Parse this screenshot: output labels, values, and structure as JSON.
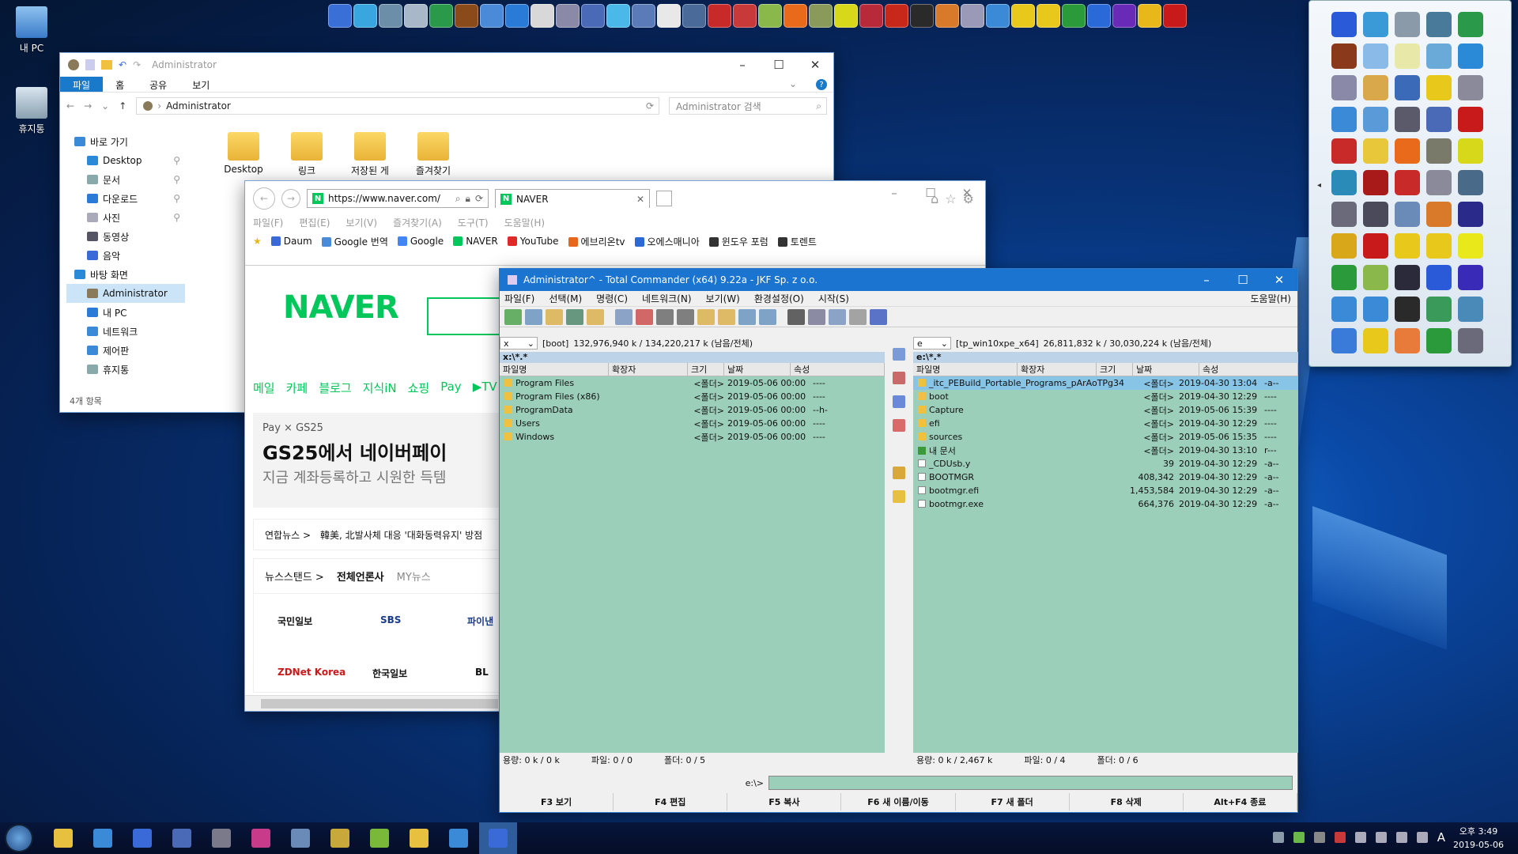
{
  "desktop": {
    "icons": [
      {
        "label": "내 PC",
        "icon": "computer-icon"
      },
      {
        "label": "휴지통",
        "icon": "recycle-bin-icon"
      }
    ]
  },
  "quick_bar": [
    "#3a6fd8",
    "#3aa6e0",
    "#6c8ea8",
    "#a8b8c8",
    "#2a9a4a",
    "#8a4a1a",
    "#4a8ad8",
    "#2a7ad8",
    "#d8d8d8",
    "#8a8aa8",
    "#4a6ab8",
    "#4ab8e8",
    "#5a7ab8",
    "#e8e8e8",
    "#4a6a9a",
    "#c82a2a",
    "#c83a3a",
    "#8ab84a",
    "#e86a1a",
    "#8a9a5a",
    "#d8d81a",
    "#b82a3a",
    "#c8281a",
    "#2a2a2a",
    "#d87a2a",
    "#9a9ab8",
    "#3a8ad8",
    "#e8c81a",
    "#e8c81a",
    "#2a9a3a",
    "#2a6ad8",
    "#6a2ab8",
    "#e8b81a",
    "#c81a1a"
  ],
  "explorer": {
    "title": "Administrator",
    "ribbon_tabs": [
      "파일",
      "홈",
      "공유",
      "보기"
    ],
    "address": "Administrator",
    "search_placeholder": "Administrator 검색",
    "nav": [
      {
        "label": "바로 가기",
        "sub": false
      },
      {
        "label": "Desktop",
        "sub": true,
        "pin": true
      },
      {
        "label": "문서",
        "sub": true,
        "pin": true
      },
      {
        "label": "다운로드",
        "sub": true,
        "pin": true
      },
      {
        "label": "사진",
        "sub": true,
        "pin": true
      },
      {
        "label": "동영상",
        "sub": true
      },
      {
        "label": "음악",
        "sub": true
      },
      {
        "label": "바탕 화면",
        "sub": false
      },
      {
        "label": "Administrator",
        "sub": true,
        "selected": true
      },
      {
        "label": "내 PC",
        "sub": true
      },
      {
        "label": "네트워크",
        "sub": true
      },
      {
        "label": "제어판",
        "sub": true
      },
      {
        "label": "휴지통",
        "sub": true
      }
    ],
    "items": [
      "Desktop",
      "링크",
      "저장된 게",
      "즐겨찾기"
    ],
    "status": "4개 항목"
  },
  "ie": {
    "url": "https://www.naver.com/",
    "tab_title": "NAVER",
    "menu": [
      "파일(F)",
      "편집(E)",
      "보기(V)",
      "즐겨찾기(A)",
      "도구(T)",
      "도움말(H)"
    ],
    "favorites": [
      "Daum",
      "Google 번역",
      "Google",
      "NAVER",
      "YouTube",
      "에브리온tv",
      "오에스매니아",
      "윈도우 포럼",
      "토렌트"
    ],
    "page": {
      "logo": "NAVER",
      "menu": [
        "메일",
        "카페",
        "블로그",
        "지식iN",
        "쇼핑",
        "Pay",
        "▶TV"
      ],
      "ad_line1": "Pay × GS25",
      "ad_line2": "GS25에서 네이버페이",
      "ad_line3": "지금 계좌등록하고 시원한 득템",
      "news_source": "연합뉴스 >",
      "news_headline": "韓美, 北발사체 대응 '대화동력유지' 방점",
      "newsstand_tabs": [
        "뉴스스탠드 >",
        "전체언론사",
        "MY뉴스"
      ],
      "publishers": [
        "국민일보",
        "SBS",
        "파이낸",
        "ZDNet Korea",
        "한국일보",
        "BL"
      ]
    }
  },
  "tc": {
    "title": "Administrator^ - Total Commander (x64) 9.22a - JKF Sp. z o.o.",
    "menu": [
      "파일(F)",
      "선택(M)",
      "명령(C)",
      "네트워크(N)",
      "보기(W)",
      "환경설정(O)",
      "시작(S)"
    ],
    "help": "도움말(H)",
    "columns": [
      "파일명",
      "확장자",
      "크기",
      "날짜",
      "속성"
    ],
    "left": {
      "drive": "x",
      "label": "[boot]",
      "space": "132,976,940 k / 134,220,217 k (남음/전체)",
      "path": "x:\\*.*",
      "files": [
        {
          "name": "Program Files",
          "size": "<폴더>",
          "date": "2019-05-06 00:00",
          "attr": "----",
          "type": "d"
        },
        {
          "name": "Program Files (x86)",
          "size": "<폴더>",
          "date": "2019-05-06 00:00",
          "attr": "----",
          "type": "d"
        },
        {
          "name": "ProgramData",
          "size": "<폴더>",
          "date": "2019-05-06 00:00",
          "attr": "--h-",
          "type": "d"
        },
        {
          "name": "Users",
          "size": "<폴더>",
          "date": "2019-05-06 00:00",
          "attr": "----",
          "type": "d"
        },
        {
          "name": "Windows",
          "size": "<폴더>",
          "date": "2019-05-06 00:00",
          "attr": "----",
          "type": "d"
        }
      ],
      "status": [
        "용량: 0 k / 0 k",
        "파일: 0 / 0",
        "폴더: 0 / 5"
      ]
    },
    "right": {
      "drive": "e",
      "label": "[tp_win10xpe_x64]",
      "space": "26,811,832 k / 30,030,224 k (남음/전체)",
      "path": "e:\\*.*",
      "files": [
        {
          "name": "_itc_PEBuild_Portable_Programs_pArAoTPg34",
          "size": "<폴더>",
          "date": "2019-04-30 13:04",
          "attr": "-a--",
          "type": "d",
          "hl": true
        },
        {
          "name": "boot",
          "size": "<폴더>",
          "date": "2019-04-30 12:29",
          "attr": "----",
          "type": "d"
        },
        {
          "name": "Capture",
          "size": "<폴더>",
          "date": "2019-05-06 15:39",
          "attr": "----",
          "type": "d"
        },
        {
          "name": "efi",
          "size": "<폴더>",
          "date": "2019-04-30 12:29",
          "attr": "----",
          "type": "d"
        },
        {
          "name": "sources",
          "size": "<폴더>",
          "date": "2019-05-06 15:35",
          "attr": "----",
          "type": "d"
        },
        {
          "name": "내 문서",
          "size": "<폴더>",
          "date": "2019-04-30 13:10",
          "attr": "r---",
          "type": "u"
        },
        {
          "name": "_CDUsb.y",
          "size": "39",
          "date": "2019-04-30 12:29",
          "attr": "-a--",
          "type": "f"
        },
        {
          "name": "BOOTMGR",
          "size": "408,342",
          "date": "2019-04-30 12:29",
          "attr": "-a--",
          "type": "f"
        },
        {
          "name": "bootmgr.efi",
          "size": "1,453,584",
          "date": "2019-04-30 12:29",
          "attr": "-a--",
          "type": "f"
        },
        {
          "name": "bootmgr.exe",
          "size": "664,376",
          "date": "2019-04-30 12:29",
          "attr": "-a--",
          "type": "f"
        }
      ],
      "status": [
        "용량: 0 k / 2,467 k",
        "파일: 0 / 4",
        "폴더: 0 / 6"
      ]
    },
    "cmd_prompt": "e:\\>",
    "fkeys": [
      "F3 보기",
      "F4 편집",
      "F5 복사",
      "F6 새 이름/이동",
      "F7 새 폴더",
      "F8 삭제",
      "Alt+F4 종료"
    ]
  },
  "launcher": {
    "icons": [
      "#2a5ad8",
      "#3a9ad8",
      "#8a9aa8",
      "#4a7a9a",
      "#2a9a4a",
      "#8a3a1a",
      "#8abae8",
      "#e8e8a8",
      "#6aaad8",
      "#2a8ad8",
      "#8a8aa8",
      "#d8a84a",
      "#3a6ab8",
      "#e8c81a",
      "#8a8a9a",
      "#3a8ad8",
      "#5a9ad8",
      "#5a5a6a",
      "#4a6ab8",
      "#c81a1a",
      "#c82a2a",
      "#e8c83a",
      "#e86a1a",
      "#7a7a6a",
      "#d8d81a",
      "#2a8ab8",
      "#a81a1a",
      "#c82a2a",
      "#8a8a9a",
      "#4a6a8a",
      "#6a6a7a",
      "#4a4a5a",
      "#6a8ab8",
      "#d87a2a",
      "#2a2a8a",
      "#d8a81a",
      "#c81a1a",
      "#e8c81a",
      "#e8c81a",
      "#e8e81a",
      "#2a9a3a",
      "#8ab84a",
      "#2a2a3a",
      "#2a5ad8",
      "#3a2ab8",
      "#3a8ad8",
      "#3a8ad8",
      "#2a2a2a",
      "#3a9a5a",
      "#4a8ab8",
      "#3a7ad8",
      "#e8c81a",
      "#e87a3a",
      "#2a9a3a",
      "#6a6a7a"
    ],
    "handle": "RH"
  },
  "taskbar": {
    "items": [
      {
        "icon": "folder-icon",
        "color": "#e8c040"
      },
      {
        "icon": "ie-icon",
        "color": "#3a8ad8"
      },
      {
        "icon": "floppy-icon",
        "color": "#3a6ad8"
      },
      {
        "icon": "app-icon",
        "color": "#4a6ab8"
      },
      {
        "icon": "gear-icon",
        "color": "#7a7a8a"
      },
      {
        "icon": "color-icon",
        "color": "#c83a8a"
      },
      {
        "icon": "monitor-icon",
        "color": "#6a8ab8"
      },
      {
        "icon": "film-icon",
        "color": "#c8a83a"
      },
      {
        "icon": "leaf-icon",
        "color": "#7ab83a"
      },
      {
        "icon": "notepad-icon",
        "color": "#e8c040"
      },
      {
        "icon": "ie-icon",
        "color": "#3a8ad8"
      },
      {
        "icon": "floppy-icon",
        "color": "#3a6ad8",
        "active": true
      }
    ],
    "time": "오후 3:49",
    "date": "2019-05-06",
    "ime": "A"
  }
}
